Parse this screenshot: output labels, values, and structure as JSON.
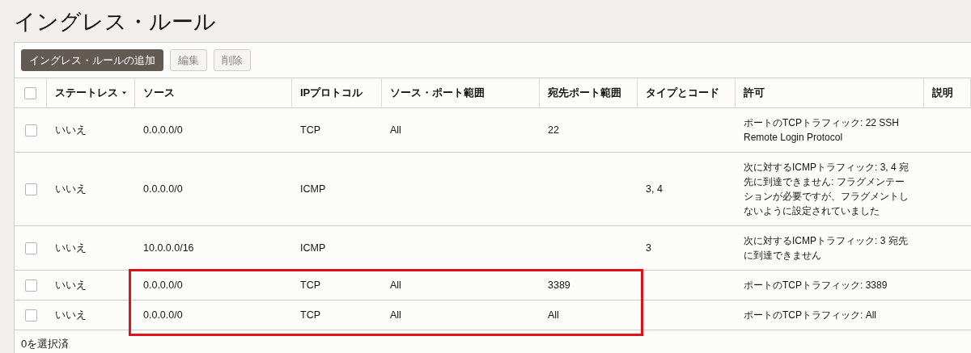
{
  "title": "イングレス・ルール",
  "buttons": [
    {
      "label": "イングレス・ルールの追加",
      "kind": "primary",
      "disabled": false
    },
    {
      "label": "編集",
      "kind": "secondary",
      "disabled": true
    },
    {
      "label": "削除",
      "kind": "secondary",
      "disabled": true
    }
  ],
  "table": {
    "select_all": {
      "checked": false
    },
    "columns": [
      {
        "label": "ステートレス",
        "sorted": true
      },
      {
        "label": "ソース",
        "sorted": false
      },
      {
        "label": "IPプロトコル",
        "sorted": false
      },
      {
        "label": "ソース・ポート範囲",
        "sorted": false
      },
      {
        "label": "宛先ポート範囲",
        "sorted": false
      },
      {
        "label": "タイプとコード",
        "sorted": false
      },
      {
        "label": "許可",
        "sorted": false
      },
      {
        "label": "説明",
        "sorted": false
      }
    ],
    "rows": [
      {
        "checked": false,
        "highlighted": false,
        "cells": [
          "いいえ",
          "0.0.0.0/0",
          "TCP",
          "All",
          "22",
          null,
          "ポートのTCPトラフィック: 22 SSH Remote Login Protocol",
          null
        ]
      },
      {
        "checked": false,
        "highlighted": false,
        "cells": [
          "いいえ",
          "0.0.0.0/0",
          "ICMP",
          null,
          null,
          "3, 4",
          "次に対するICMPトラフィック: 3, 4 宛先に到達できません: フラグメンテーションが必要ですが、フラグメントしないように設定されていました",
          null
        ]
      },
      {
        "checked": false,
        "highlighted": false,
        "cells": [
          "いいえ",
          "10.0.0.0/16",
          "ICMP",
          null,
          null,
          "3",
          "次に対するICMPトラフィック: 3 宛先に到達できません",
          null
        ]
      },
      {
        "checked": false,
        "highlighted": true,
        "cells": [
          "いいえ",
          "0.0.0.0/0",
          "TCP",
          "All",
          "3389",
          null,
          "ポートのTCPトラフィック: 3389",
          null
        ]
      },
      {
        "checked": false,
        "highlighted": true,
        "cells": [
          "いいえ",
          "0.0.0.0/0",
          "TCP",
          "All",
          "All",
          null,
          "ポートのTCPトラフィック: All",
          null
        ]
      }
    ]
  },
  "footer": "0を選択済"
}
